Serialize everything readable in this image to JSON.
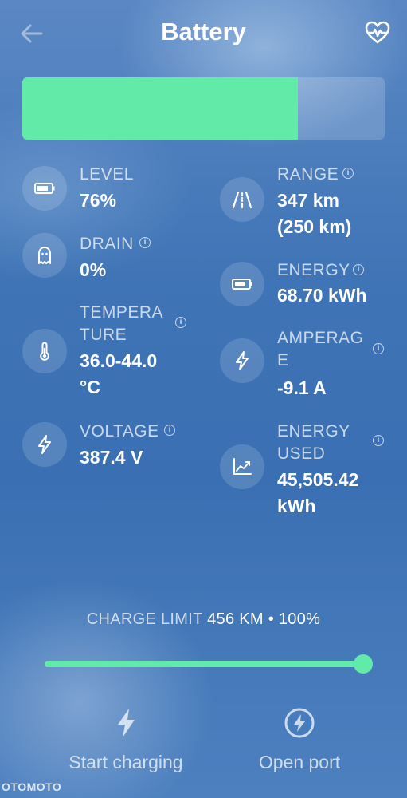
{
  "header": {
    "title": "Battery",
    "back_icon": "arrow-left-icon",
    "health_icon": "heart-pulse-icon"
  },
  "battery_bar": {
    "level_fraction": 0.76,
    "fill_color": "#62eaa8"
  },
  "stats": {
    "level": {
      "label": "LEVEL",
      "value": "76%",
      "icon": "battery-icon"
    },
    "drain": {
      "label": "DRAIN",
      "value": "0%",
      "icon": "ghost-icon"
    },
    "temperature": {
      "label": "TEMPERA\nTURE",
      "value": "36.0-44.0\n°C",
      "icon": "thermometer-icon"
    },
    "voltage": {
      "label": "VOLTAGE",
      "value": "387.4 V",
      "icon": "lightning-icon"
    },
    "range": {
      "label": "RANGE",
      "value": "347 km\n(250 km)",
      "icon": "road-icon"
    },
    "energy": {
      "label": "ENERGY",
      "value": "68.70 kWh",
      "icon": "battery-icon"
    },
    "amperage": {
      "label": "AMPERAG\nE",
      "value": "-9.1 A",
      "icon": "lightning-icon"
    },
    "energy_used": {
      "label": "ENERGY\nUSED",
      "value": "45,505.42\nkWh",
      "icon": "trend-chart-icon"
    }
  },
  "charge_limit": {
    "label": "CHARGE LIMIT",
    "value": "456 KM • 100%",
    "level_fraction": 1.0
  },
  "actions": {
    "start_charging": {
      "label": "Start charging",
      "icon": "lightning-icon"
    },
    "open_port": {
      "label": "Open port",
      "icon": "lightning-circle-icon"
    }
  },
  "watermark": "OTOMOTO",
  "colors": {
    "accent": "#62eaa8"
  }
}
